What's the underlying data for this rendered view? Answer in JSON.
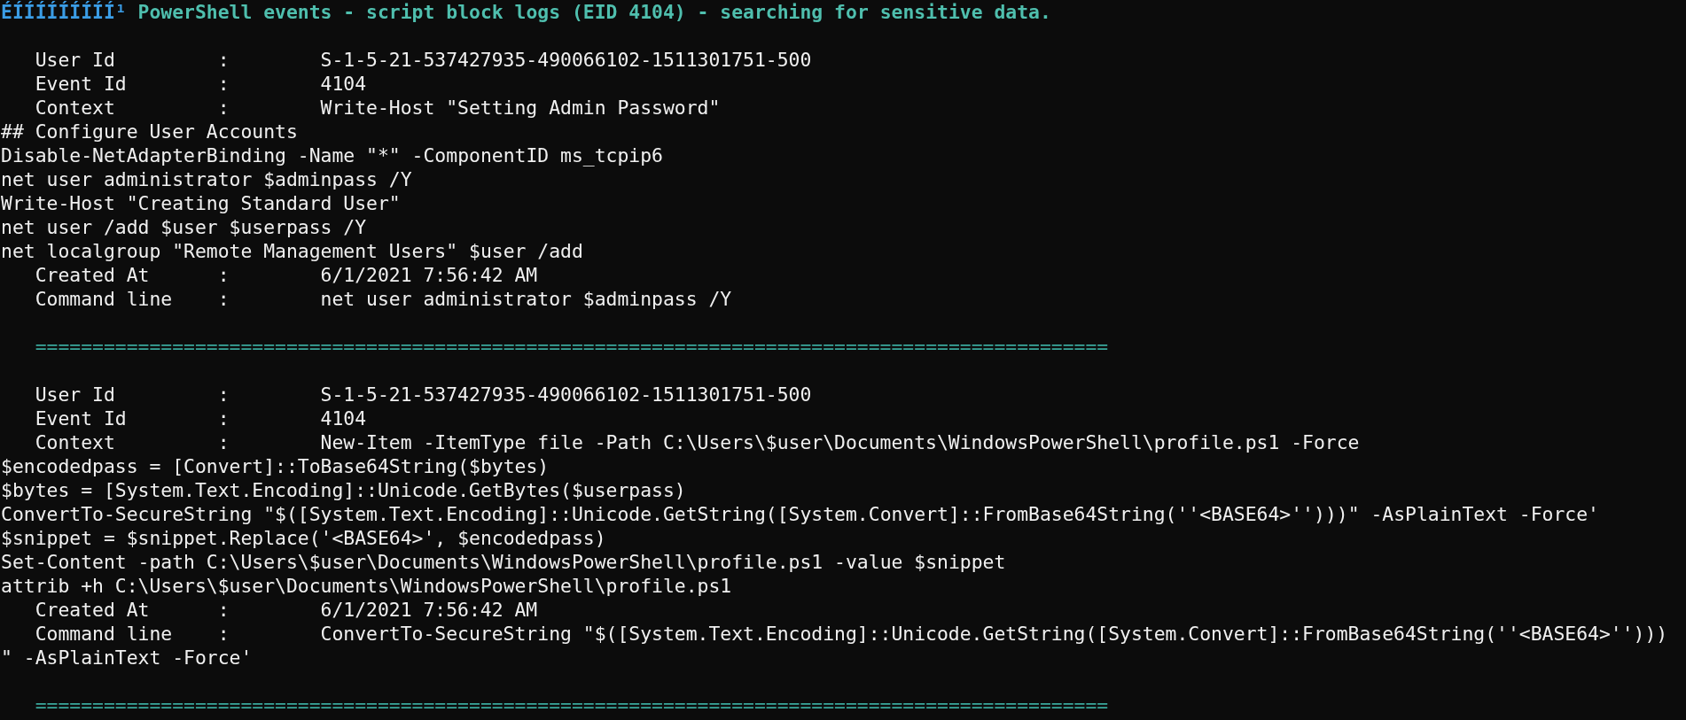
{
  "header": {
    "prefix": "ÉÍÍÍÍÍÍÍÍÍ¹",
    "title": "PowerShell events - script block logs (EID 4104) - searching for sensitive data."
  },
  "lines": [
    {
      "kind": "blank"
    },
    {
      "kind": "field",
      "label": "User Id",
      "colon": ":",
      "value": "S-1-5-21-537427935-490066102-1511301751-500"
    },
    {
      "kind": "field",
      "label": "Event Id",
      "colon": ":",
      "value": "4104"
    },
    {
      "kind": "field",
      "label": "Context",
      "colon": ":",
      "value": "Write-Host \"Setting Admin Password\""
    },
    {
      "kind": "code",
      "text": "## Configure User Accounts"
    },
    {
      "kind": "code",
      "text": "Disable-NetAdapterBinding -Name \"*\" -ComponentID ms_tcpip6"
    },
    {
      "kind": "code",
      "text": "net user administrator $adminpass /Y"
    },
    {
      "kind": "code",
      "text": "Write-Host \"Creating Standard User\""
    },
    {
      "kind": "code",
      "text": "net user /add $user $userpass /Y"
    },
    {
      "kind": "code",
      "text": "net localgroup \"Remote Management Users\" $user /add"
    },
    {
      "kind": "field",
      "label": "Created At",
      "colon": ":",
      "value": "6/1/2021 7:56:42 AM"
    },
    {
      "kind": "field",
      "label": "Command line",
      "colon": ":",
      "value": "net user administrator $adminpass /Y"
    },
    {
      "kind": "blank"
    },
    {
      "kind": "separator",
      "text": "=============================================================================================="
    },
    {
      "kind": "blank"
    },
    {
      "kind": "field",
      "label": "User Id",
      "colon": ":",
      "value": "S-1-5-21-537427935-490066102-1511301751-500"
    },
    {
      "kind": "field",
      "label": "Event Id",
      "colon": ":",
      "value": "4104"
    },
    {
      "kind": "field",
      "label": "Context",
      "colon": ":",
      "value": "New-Item -ItemType file -Path C:\\Users\\$user\\Documents\\WindowsPowerShell\\profile.ps1 -Force"
    },
    {
      "kind": "code",
      "text": "$encodedpass = [Convert]::ToBase64String($bytes)"
    },
    {
      "kind": "code",
      "text": "$bytes = [System.Text.Encoding]::Unicode.GetBytes($userpass)"
    },
    {
      "kind": "code",
      "text": "ConvertTo-SecureString \"$([System.Text.Encoding]::Unicode.GetString([System.Convert]::FromBase64String(''<BASE64>'')))\" -AsPlainText -Force'"
    },
    {
      "kind": "code",
      "text": "$snippet = $snippet.Replace('<BASE64>', $encodedpass)"
    },
    {
      "kind": "code",
      "text": "Set-Content -path C:\\Users\\$user\\Documents\\WindowsPowerShell\\profile.ps1 -value $snippet"
    },
    {
      "kind": "code",
      "text": "attrib +h C:\\Users\\$user\\Documents\\WindowsPowerShell\\profile.ps1"
    },
    {
      "kind": "field",
      "label": "Created At",
      "colon": ":",
      "value": "6/1/2021 7:56:42 AM"
    },
    {
      "kind": "field",
      "label": "Command line",
      "colon": ":",
      "value": "ConvertTo-SecureString \"$([System.Text.Encoding]::Unicode.GetString([System.Convert]::FromBase64String(''<BASE64>'')))"
    },
    {
      "kind": "code",
      "text": "\" -AsPlainText -Force'"
    },
    {
      "kind": "blank"
    },
    {
      "kind": "separator",
      "text": "=============================================================================================="
    }
  ]
}
